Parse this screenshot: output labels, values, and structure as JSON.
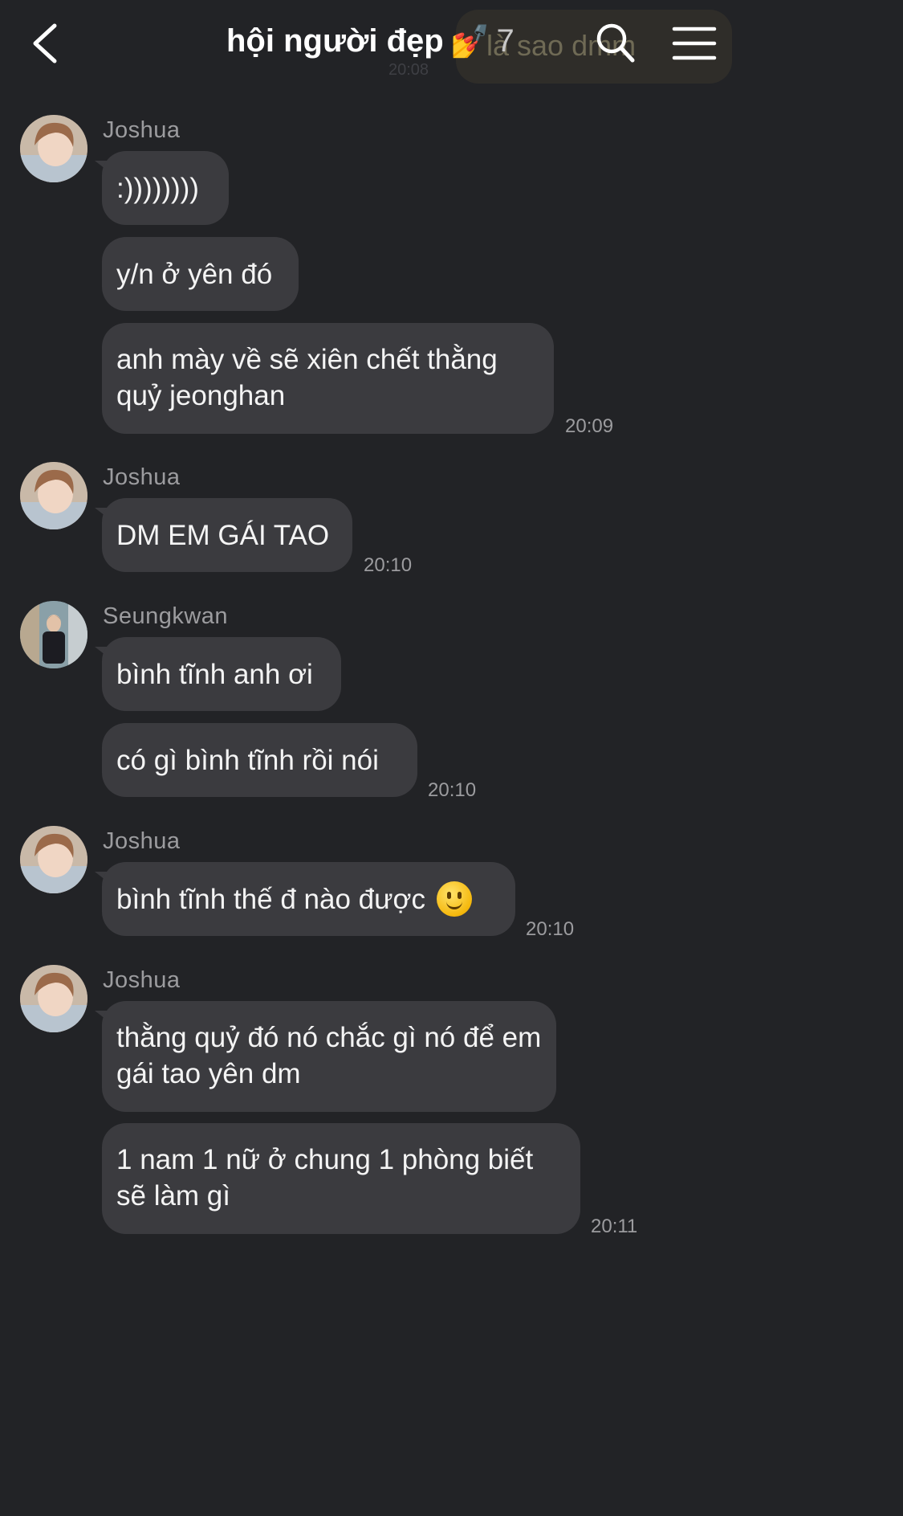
{
  "header": {
    "back_icon": "chevron-left-icon",
    "title": "hội người đẹp",
    "title_emoji": "💅",
    "member_count": "7",
    "ghost_text": "là sao dmm",
    "ghost_time": "20:08",
    "search_icon": "search-icon",
    "menu_icon": "hamburger-menu-icon"
  },
  "messages": [
    {
      "sender": "Joshua",
      "texts": [
        ":))))))))",
        "y/n ở yên đó",
        "anh mày về sẽ xiên chết thằng quỷ jeonghan"
      ],
      "time": "20:09"
    },
    {
      "sender": "Joshua",
      "texts": [
        "DM EM GÁI TAO"
      ],
      "time": "20:10"
    },
    {
      "sender": "Seungkwan",
      "texts": [
        "bình tĩnh anh ơi",
        "có gì bình tĩnh rồi nói"
      ],
      "time": "20:10"
    },
    {
      "sender": "Joshua",
      "texts": [
        "bình tĩnh thế đ nào được"
      ],
      "emoji": "slightly-smiling-face",
      "time": "20:10"
    },
    {
      "sender": "Joshua",
      "texts": [
        "thằng quỷ đó nó chắc gì nó để em gái tao yên dm",
        "1 nam 1 nữ ở chung 1 phòng biết sẽ làm gì"
      ],
      "time": "20:11"
    }
  ],
  "colors": {
    "background": "#222326",
    "bubble": "#3b3b3f",
    "secondary_text": "#9c9c9f"
  }
}
